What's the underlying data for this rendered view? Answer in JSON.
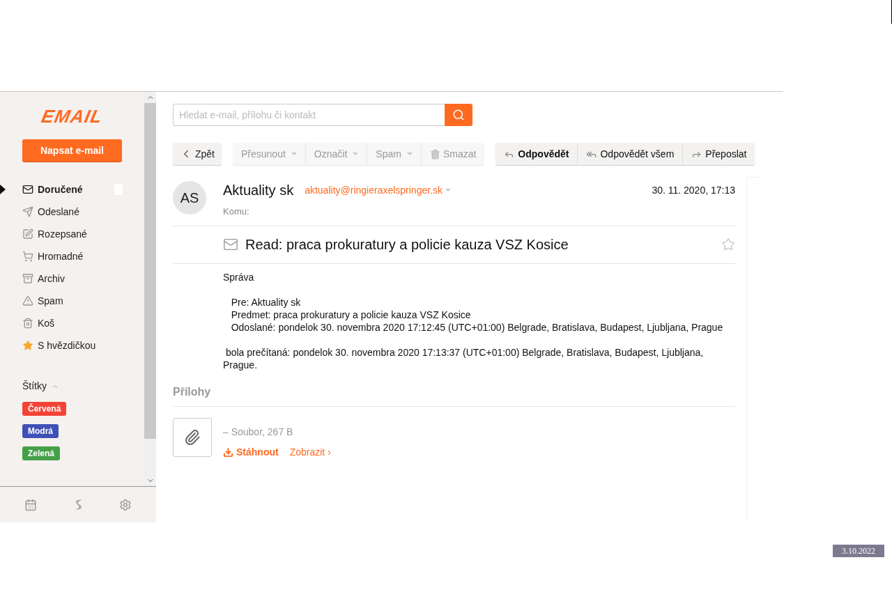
{
  "sidebar": {
    "logo": "EMAIL",
    "compose": "Napsat e-mail",
    "folders": [
      {
        "label": "Doručené",
        "kind": "inbox",
        "selected": true
      },
      {
        "label": "Odeslané",
        "kind": "sent",
        "selected": false
      },
      {
        "label": "Rozepsané",
        "kind": "draft",
        "selected": false
      },
      {
        "label": "Hromadné",
        "kind": "bulk",
        "selected": false
      },
      {
        "label": "Archiv",
        "kind": "archive",
        "selected": false
      },
      {
        "label": "Spam",
        "kind": "spam",
        "selected": false
      },
      {
        "label": "Koš",
        "kind": "trash",
        "selected": false
      },
      {
        "label": "S hvězdičkou",
        "kind": "starred",
        "selected": false
      }
    ],
    "labels_title": "Štítky",
    "labels_expanded": true,
    "labels": [
      {
        "label": "Červená",
        "color": "#f44336"
      },
      {
        "label": "Modrá",
        "color": "#3f51b5"
      },
      {
        "label": "Zelená",
        "color": "#43a047"
      }
    ]
  },
  "search": {
    "placeholder": "Hledat e-mail, přílohu či kontakt"
  },
  "toolbar": {
    "back": "Zpět",
    "actions": [
      {
        "label": "Přesunout",
        "kind": "menu"
      },
      {
        "label": "Označit",
        "kind": "menu"
      },
      {
        "label": "Spam",
        "kind": "menu"
      },
      {
        "label": "Smazat",
        "kind": "delete"
      }
    ],
    "replies": [
      {
        "label": "Odpovědět",
        "kind": "reply"
      },
      {
        "label": "Odpovědět všem",
        "kind": "reply-all"
      },
      {
        "label": "Přeposlat",
        "kind": "forward"
      }
    ]
  },
  "message": {
    "avatar": "AS",
    "sender": "Aktuality sk",
    "address": "aktuality@ringieraxelspringer.sk",
    "date": "30. 11. 2020, 17:13",
    "to_label": "Komu:",
    "subject": "Read: praca prokuratury a policie kauza VSZ Kosice",
    "starred": false,
    "body": [
      [
        "Správa"
      ],
      [
        "   Pre: Aktuality sk",
        "   Predmet: praca prokuratury a policie kauza VSZ Kosice",
        "   Odoslané: pondelok 30. novembra 2020 17:12:45 (UTC+01:00) Belgrade, Bratislava, Budapest, Ljubljana, Prague"
      ],
      [
        " bola prečítaná: pondelok 30. novembra 2020 17:13:37 (UTC+01:00) Belgrade, Bratislava, Budapest, Ljubljana, Prague."
      ]
    ]
  },
  "attachments": {
    "title": "Přílohy",
    "items": [
      {
        "name": "– Soubor, 267 B",
        "download": "Stáhnout",
        "view": "Zobrazit ›"
      }
    ]
  },
  "stamp": "3.10.2022"
}
